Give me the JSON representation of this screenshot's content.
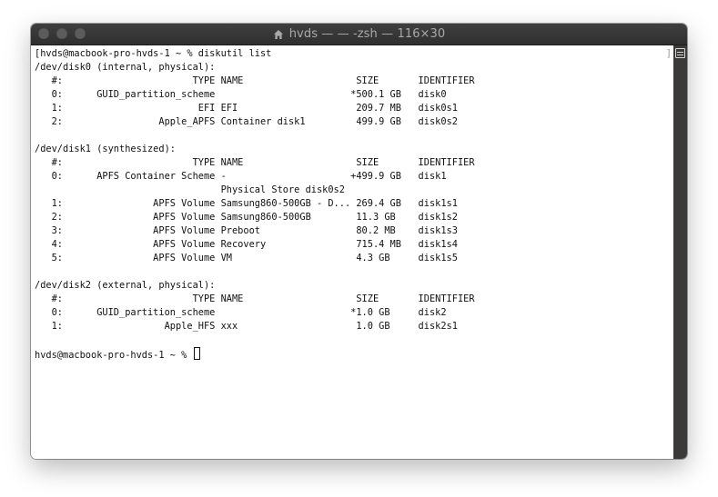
{
  "window": {
    "title": "hvds — — -zsh — 116×30",
    "right_bracket": "]"
  },
  "terminal": {
    "lines": [
      "[hvds@macbook-pro-hvds-1 ~ % diskutil list",
      "/dev/disk0 (internal, physical):",
      "   #:                       TYPE NAME                    SIZE       IDENTIFIER",
      "   0:      GUID_partition_scheme                        *500.1 GB   disk0",
      "   1:                        EFI EFI                     209.7 MB   disk0s1",
      "   2:                 Apple_APFS Container disk1         499.9 GB   disk0s2",
      "",
      "/dev/disk1 (synthesized):",
      "   #:                       TYPE NAME                    SIZE       IDENTIFIER",
      "   0:      APFS Container Scheme -                      +499.9 GB   disk1",
      "                                 Physical Store disk0s2",
      "   1:                APFS Volume Samsung860-500GB - D... 269.4 GB   disk1s1",
      "   2:                APFS Volume Samsung860-500GB        11.3 GB    disk1s2",
      "   3:                APFS Volume Preboot                 80.2 MB    disk1s3",
      "   4:                APFS Volume Recovery                715.4 MB   disk1s4",
      "   5:                APFS Volume VM                      4.3 GB     disk1s5",
      "",
      "/dev/disk2 (external, physical):",
      "   #:                       TYPE NAME                    SIZE       IDENTIFIER",
      "   0:      GUID_partition_scheme                        *1.0 GB     disk2",
      "   1:                  Apple_HFS xxx                     1.0 GB     disk2s1",
      ""
    ],
    "prompt": "hvds@macbook-pro-hvds-1 ~ % "
  }
}
